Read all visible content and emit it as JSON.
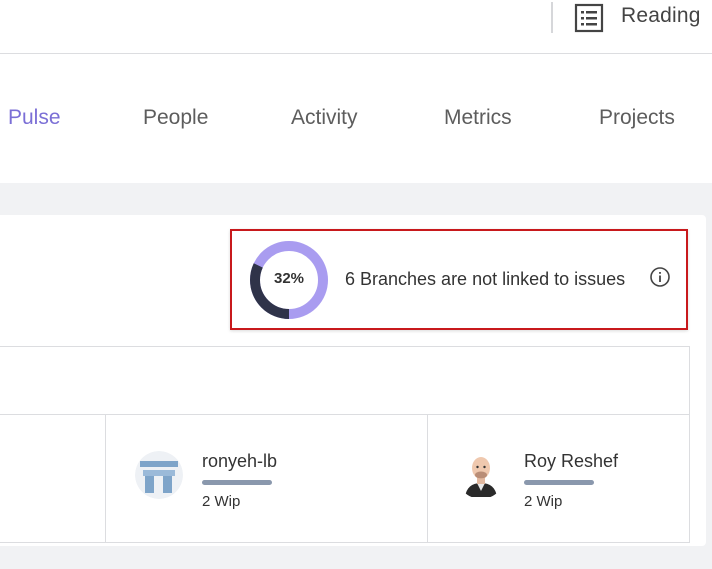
{
  "header": {
    "reading_label": "Reading",
    "reading_icon": "reading-list-icon"
  },
  "tabs": [
    {
      "label": "Pulse",
      "active": true
    },
    {
      "label": "People",
      "active": false
    },
    {
      "label": "Activity",
      "active": false
    },
    {
      "label": "Metrics",
      "active": false
    },
    {
      "label": "Projects",
      "active": false
    }
  ],
  "branch_summary": {
    "percent_label": "32%",
    "percent_value": 32,
    "message": "6 Branches are not linked to issues",
    "info_icon": "info-icon",
    "colors": {
      "filled": "#2f3349",
      "remaining": "#a99cf0",
      "highlight_border": "#c8191c"
    }
  },
  "users": [
    {
      "name": "ronyeh-lb",
      "wip": "2 Wip",
      "avatar": "ronyeh-lb-avatar"
    },
    {
      "name": "Roy Reshef",
      "wip": "2 Wip",
      "avatar": "roy-reshef-avatar"
    }
  ],
  "colors": {
    "accent": "#7b6fd6",
    "tab_text": "#5d5d5d",
    "bar": "#8a98ad"
  }
}
